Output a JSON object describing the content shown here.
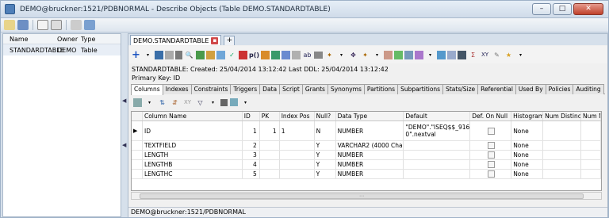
{
  "window": {
    "title": "DEMO@bruckner:1521/PDBNORMAL - Describe Objects (Table DEMO.STANDARDTABLE)",
    "buttons": [
      "–",
      "□",
      "✕"
    ]
  },
  "left_panel": {
    "columns": [
      "Name",
      "Owner",
      "Type"
    ],
    "rows": [
      {
        "name": "STANDARDTABLE",
        "owner": "DEMO",
        "type": "Table"
      }
    ]
  },
  "tabs": [
    {
      "label": "DEMO.STANDARDTABLE"
    }
  ],
  "info": {
    "line1": "STANDARDTABLE:   Created: 25/04/2014 13:12:42   Last DDL: 25/04/2014 13:12:42",
    "line2": "Primary Key:  ID"
  },
  "subtabs": [
    "Columns",
    "Indexes",
    "Constraints",
    "Triggers",
    "Data",
    "Script",
    "Grants",
    "Synonyms",
    "Partitions",
    "Subpartitions",
    "Stats/Size",
    "Referential",
    "Used By",
    "Policies",
    "Auditing"
  ],
  "grid": {
    "headers": [
      "Column Name",
      "ID",
      "PK",
      "Index Pos",
      "Null?",
      "Data Type",
      "Default",
      "Def. On Null",
      "Histogram",
      "Num Distinct",
      "Num N"
    ],
    "rows": [
      {
        "name": "ID",
        "id": "1",
        "pk": "1",
        "index_pos": "1",
        "null": "N",
        "type": "NUMBER",
        "default": "\"DEMO\".\"ISEQ$$_9160 0\".nextval",
        "histogram": "None"
      },
      {
        "name": "TEXTFIELD",
        "id": "2",
        "pk": "",
        "index_pos": "",
        "null": "Y",
        "type": "VARCHAR2 (4000 Char)",
        "default": "",
        "histogram": "None"
      },
      {
        "name": "LENGTH",
        "id": "3",
        "pk": "",
        "index_pos": "",
        "null": "Y",
        "type": "NUMBER",
        "default": "",
        "histogram": "None"
      },
      {
        "name": "LENGTHB",
        "id": "4",
        "pk": "",
        "index_pos": "",
        "null": "Y",
        "type": "NUMBER",
        "default": "",
        "histogram": "None"
      },
      {
        "name": "LENGTHC",
        "id": "5",
        "pk": "",
        "index_pos": "",
        "null": "Y",
        "type": "NUMBER",
        "default": "",
        "histogram": "None"
      }
    ]
  },
  "status": "DEMO@bruckner:1521/PDBNORMAL",
  "colors": {
    "accent": "#4f7fb8",
    "selected_row": "#e8eef6"
  }
}
